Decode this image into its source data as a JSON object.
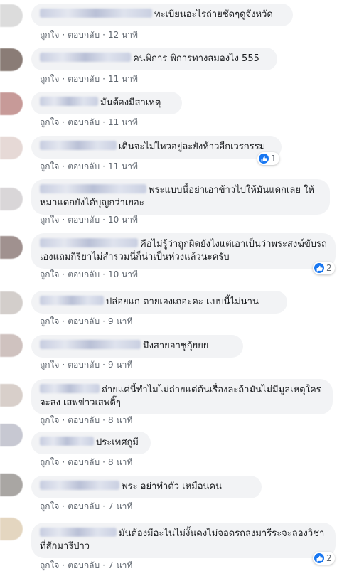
{
  "actions": {
    "like": "ถูกใจ",
    "reply": "ตอบกลับ",
    "separator": "·"
  },
  "comments": [
    {
      "avatar_color": "#dcdcdc",
      "text": "ทะเบียนอะไรถ่ายชัดๆดูจังหวัด",
      "time": "12 นาที",
      "reactions": null
    },
    {
      "avatar_color": "#8a7c76",
      "text": "คนพิการ พิการทางสมองไง 555",
      "time": "11 นาที",
      "reactions": null
    },
    {
      "avatar_color": "#c79a98",
      "text": "มันต้องมีสาเหตุ",
      "time": "11 นาที",
      "reactions": null
    },
    {
      "avatar_color": "#e6d9d6",
      "text": "เดินจะไม่ไหวอยู่ละยังห้าวอีกเวรกรรม",
      "time": "11 นาที",
      "reactions": "1"
    },
    {
      "avatar_color": "#d9d6d8",
      "text": "พระแบบนี้อย่าเอาข้าวไปให้มันแดกเลย ให้หมาแดกยังได้บุญกว่าเยอะ",
      "time": "10 นาที",
      "reactions": null
    },
    {
      "avatar_color": "#a0918f",
      "text": "คือไม่รู้ว่าถูกผิดยังไงแต่เอาเป็นว่าพระสงฆ์ขับรถเองแถมกิริยาไม่สำรวมนี่ก็น่าเป็นห่วงแล้วนะครับ",
      "time": "10 นาที",
      "reactions": "2"
    },
    {
      "avatar_color": "#d3cecb",
      "text": "ปล่อยแก ตายเองเถอะคะ แบบนี้ไม่นาน",
      "time": "9 นาที",
      "reactions": null
    },
    {
      "avatar_color": "#cfc2bf",
      "text": "มึงสายอาชูกุ้ยยย",
      "time": "9 นาที",
      "reactions": null
    },
    {
      "avatar_color": "#d8cfca",
      "text": "ถ่ายแค่นี้ทำไมไม่ถ่ายแต่ต้นเรื่องละถ้ามันไม่มีมูลเหตุใครจะลง เสพข่าวเสพติ๊ๆ",
      "time": "8 นาที",
      "reactions": null
    },
    {
      "avatar_color": "#c7c8d2",
      "text": "ประเทศกูมี",
      "time": "8 นาที",
      "reactions": null
    },
    {
      "avatar_color": "#a9a6a3",
      "text": "พระ อย่าทำตัว เหมือนคน",
      "time": "7 นาที",
      "reactions": null
    },
    {
      "avatar_color": "#e4d6c0",
      "text": "มันต้องมีอะไนไม่งั้นคงไม่จอดรถลงมารีระจะลองวิชาที่สักมารึป่าว",
      "time": "7 นาที",
      "reactions": "2"
    }
  ]
}
